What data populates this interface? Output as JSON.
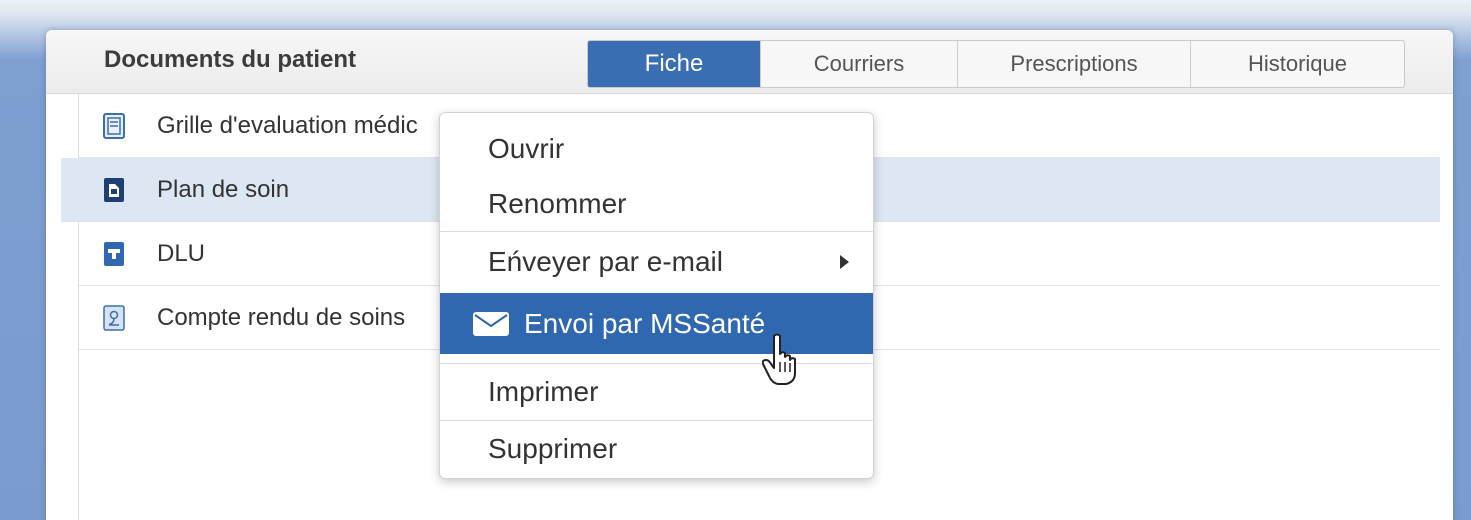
{
  "panel": {
    "title": "Documents du patient"
  },
  "tabs": [
    {
      "label": "Fiche",
      "active": true
    },
    {
      "label": "Courriers",
      "active": false
    },
    {
      "label": "Prescriptions",
      "active": false
    },
    {
      "label": "Historique",
      "active": false
    }
  ],
  "documents": [
    {
      "label": "Grille d'evaluation médic",
      "icon": "form-document-icon"
    },
    {
      "label": "Plan de soin",
      "icon": "care-plan-document-icon",
      "selected": true
    },
    {
      "label": "DLU",
      "icon": "dlu-document-icon"
    },
    {
      "label": "Compte rendu de soins",
      "icon": "report-document-icon"
    }
  ],
  "context_menu": {
    "items": [
      {
        "label": "Ouvrir"
      },
      {
        "label": "Renommer"
      },
      {
        "label": "Eńveyer par e-mail",
        "submenu": true
      },
      {
        "label": "Envoi par MSSanté",
        "highlighted": true,
        "icon": "envelope-icon"
      },
      {
        "label": "Imprimer"
      },
      {
        "label": "Supprimer"
      }
    ]
  },
  "colors": {
    "accent": "#3b6eb1",
    "highlight": "#2f67b0",
    "selected_row": "#dde6f3"
  }
}
